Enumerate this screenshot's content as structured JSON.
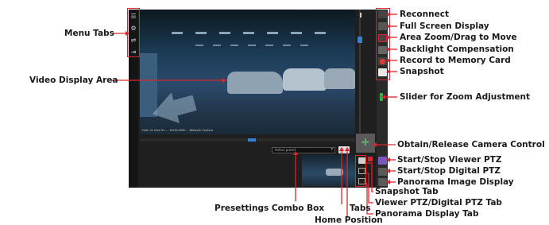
{
  "annotations": {
    "menu_tabs": "Menu Tabs",
    "video_display_area": "Video Display Area",
    "reconnect": "Reconnect",
    "full_screen_display": "Full Screen Display",
    "area_zoom": "Area Zoom/Drag to Move",
    "backlight_compensation": "Backlight Compensation",
    "record_to_memory_card": "Record to Memory Card",
    "snapshot": "Snapshot",
    "slider_zoom": "Slider for Zoom Adjustment",
    "obtain_release_control": "Obtain/Release Camera Control",
    "start_stop_viewer_ptz": "Start/Stop Viewer PTZ",
    "start_stop_digital_ptz": "Start/Stop Digital PTZ",
    "panorama_image_display": "Panorama Image Display",
    "snapshot_tab": "Snapshot Tab",
    "viewer_digital_ptz_tab": "Viewer PTZ/Digital PTZ Tab",
    "panorama_display_tab": "Panorama Display Tab",
    "presettings_combo_box": "Presettings Combo Box",
    "tabs": "Tabs",
    "home_position": "Home Position"
  },
  "ui": {
    "menu_tab_icons": [
      "list-icon",
      "gear-icon",
      "share-icon",
      "logout-icon"
    ],
    "right_toolbar_icons": [
      "reconnect-icon",
      "fullscreen-icon",
      "area-zoom-icon",
      "backlight-icon",
      "record-icon",
      "camera-icon"
    ],
    "video_status_text": "Hub: 01 Cam  01 ... 1920x1080  ...  Network Camera",
    "preset_placeholder": "Select preset",
    "colors": {
      "annotation": "#d9252b",
      "panel": "#1f1f1f",
      "video_blue": "#2a4a6b",
      "zoom_slider": "#2fb24a",
      "ptz_accent": "#7a5ab8"
    }
  }
}
